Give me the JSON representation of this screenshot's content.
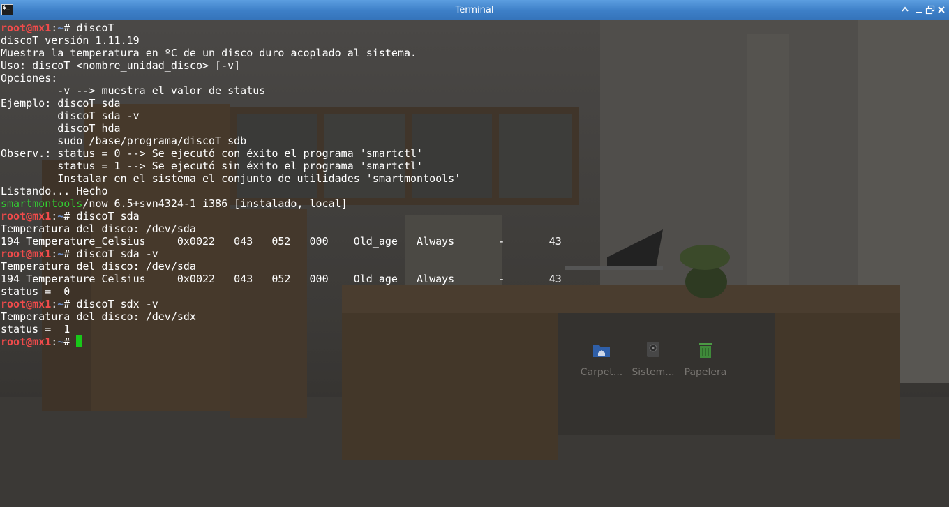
{
  "window": {
    "title": "Terminal",
    "icon_text": "$_"
  },
  "terminal": {
    "prompt": {
      "user": "root@mx1",
      "sep": ":",
      "path": "~",
      "symbol": "#"
    },
    "lines": [
      {
        "type": "prompt",
        "cmd": " discoT"
      },
      {
        "type": "text",
        "text": "discoT versión 1.11.19"
      },
      {
        "type": "text",
        "text": "Muestra la temperatura en ºC de un disco duro acoplado al sistema."
      },
      {
        "type": "text",
        "text": "Uso: discoT <nombre_unidad_disco> [-v]"
      },
      {
        "type": "text",
        "text": "Opciones:"
      },
      {
        "type": "text",
        "text": "         -v --> muestra el valor de status"
      },
      {
        "type": "text",
        "text": "Ejemplo: discoT sda"
      },
      {
        "type": "text",
        "text": "         discoT sda -v"
      },
      {
        "type": "text",
        "text": "         discoT hda"
      },
      {
        "type": "text",
        "text": "         sudo /base/programa/discoT sdb"
      },
      {
        "type": "text",
        "text": "Observ.: status = 0 --> Se ejecutó con éxito el programa 'smartctl'"
      },
      {
        "type": "text",
        "text": "         status = 1 --> Se ejecutó sin éxito el programa 'smartctl'"
      },
      {
        "type": "text",
        "text": "         Instalar en el sistema el conjunto de utilidades 'smartmontools'"
      },
      {
        "type": "text",
        "text": "Listando... Hecho"
      },
      {
        "type": "pkg",
        "pkg": "smartmontools",
        "rest": "/now 6.5+svn4324-1 i386 [instalado, local]"
      },
      {
        "type": "prompt",
        "cmd": " discoT sda"
      },
      {
        "type": "text",
        "text": "Temperatura del disco: /dev/sda"
      },
      {
        "type": "text",
        "text": "194 Temperature_Celsius     0x0022   043   052   000    Old_age   Always       -       43"
      },
      {
        "type": "prompt",
        "cmd": " discoT sda -v"
      },
      {
        "type": "text",
        "text": "Temperatura del disco: /dev/sda"
      },
      {
        "type": "text",
        "text": "194 Temperature_Celsius     0x0022   043   052   000    Old_age   Always       -       43"
      },
      {
        "type": "text",
        "text": "status =  0"
      },
      {
        "type": "prompt",
        "cmd": " discoT sdx -v"
      },
      {
        "type": "text",
        "text": "Temperatura del disco: /dev/sdx"
      },
      {
        "type": "text",
        "text": "status =  1"
      },
      {
        "type": "prompt",
        "cmd": " ",
        "cursor": true
      }
    ]
  },
  "desktop": {
    "icons": [
      {
        "label": "Carpet...",
        "icon": "home-folder-icon",
        "color": "#2f5fa8"
      },
      {
        "label": "Sistem...",
        "icon": "drive-icon",
        "color": "#555555"
      },
      {
        "label": "Papelera",
        "icon": "trash-icon",
        "color": "#3f8a3a"
      }
    ]
  },
  "colors": {
    "titlebar": "#3d7fc7",
    "prompt_user": "#f04b4b",
    "prompt_path": "#6c8ec8",
    "package": "#33cc33",
    "cursor": "#19c819"
  }
}
